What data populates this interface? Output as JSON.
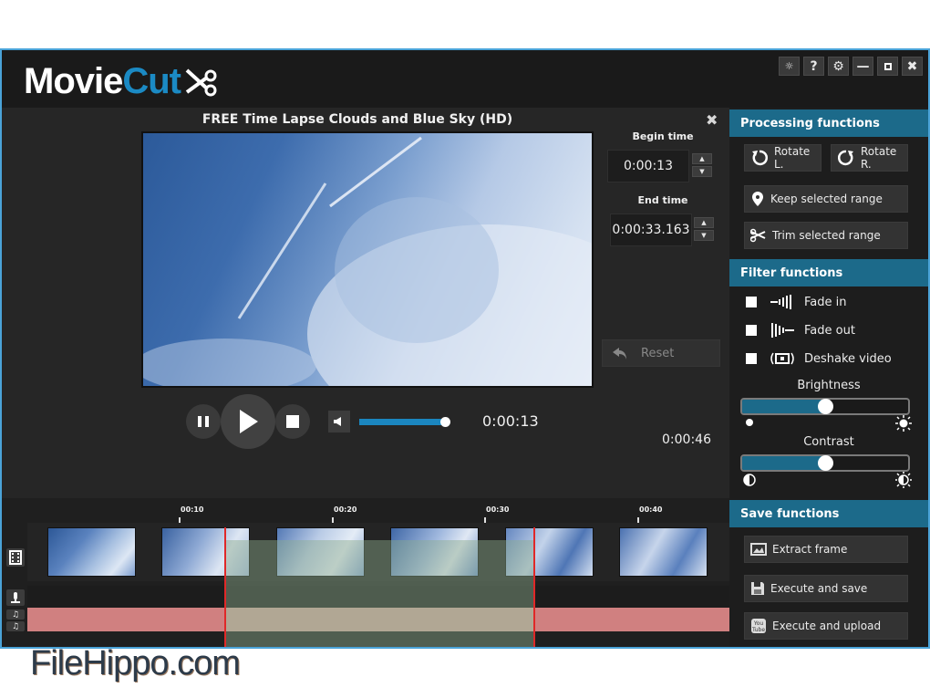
{
  "app": {
    "logo_main": "Movie",
    "logo_accent": "Cut",
    "accent_color": "#1b8ac4",
    "window_controls": [
      {
        "name": "tips",
        "icon": "lightbulb-icon",
        "glyph": "💡"
      },
      {
        "name": "help",
        "icon": "help-icon",
        "glyph": "?"
      },
      {
        "name": "settings",
        "icon": "gear-icon",
        "glyph": "⚙"
      },
      {
        "name": "minimize",
        "icon": "minimize-icon",
        "glyph": "—"
      },
      {
        "name": "maximize",
        "icon": "maximize-icon",
        "glyph": "▫"
      },
      {
        "name": "close",
        "icon": "close-icon",
        "glyph": "✖"
      }
    ]
  },
  "editor": {
    "video_title": "FREE Time Lapse Clouds and Blue Sky (HD)",
    "close_glyph": "✖",
    "begin_time_label": "Begin time",
    "begin_time_value": "0:00:13",
    "end_time_label": "End time",
    "end_time_value": "0:00:33.163",
    "spin_up": "▲",
    "spin_down": "▼",
    "reset_label": "Reset",
    "current_time": "0:00:13",
    "total_time": "0:00:46",
    "volume_percent": 100
  },
  "timeline": {
    "ruler": [
      "00:10",
      "00:20",
      "00:30",
      "00:40"
    ],
    "selection": {
      "start": "0:00:13",
      "end": "0:00:33.163"
    },
    "tracks": [
      "video",
      "voice",
      "music-1",
      "music-2"
    ]
  },
  "panel": {
    "processing": {
      "title": "Processing functions",
      "rotate_left": "Rotate L.",
      "rotate_right": "Rotate R.",
      "keep_range": "Keep selected range",
      "trim_range": "Trim selected range"
    },
    "filter": {
      "title": "Filter functions",
      "items": [
        {
          "label": "Fade in",
          "checked": false
        },
        {
          "label": "Fade out",
          "checked": false
        },
        {
          "label": "Deshake video",
          "checked": false
        }
      ],
      "brightness_label": "Brightness",
      "brightness_value": 0.5,
      "contrast_label": "Contrast",
      "contrast_value": 0.5
    },
    "save": {
      "title": "Save functions",
      "extract_frame": "Extract frame",
      "execute_save": "Execute and save",
      "execute_upload": "Execute and upload"
    }
  },
  "watermark": "FileHippo.com"
}
